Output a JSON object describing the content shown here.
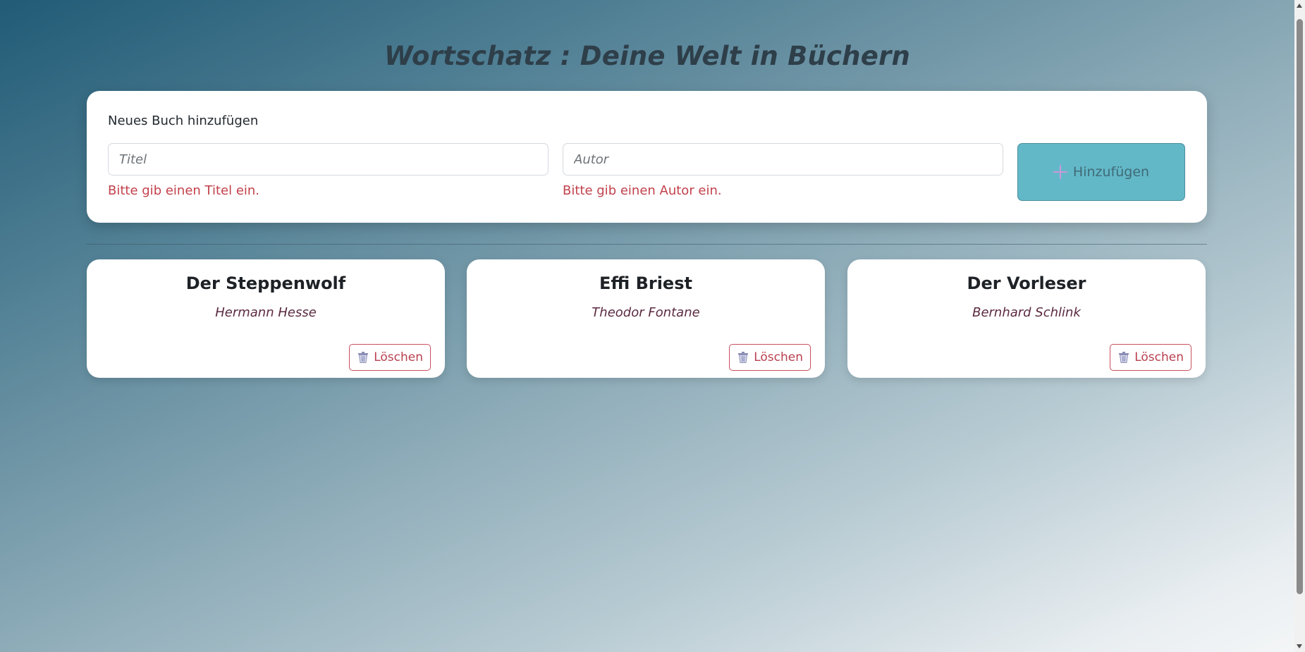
{
  "header": {
    "title": "Wortschatz : Deine Welt in Büchern"
  },
  "add_form": {
    "heading": "Neues Buch hinzufügen",
    "title_input": {
      "placeholder": "Titel",
      "value": ""
    },
    "author_input": {
      "placeholder": "Autor",
      "value": ""
    },
    "title_error": "Bitte gib einen Titel ein.",
    "author_error": "Bitte gib einen Autor ein.",
    "submit_label": "Hinzufügen",
    "submit_icon": "plus-icon"
  },
  "books": [
    {
      "title": "Der Steppenwolf",
      "author": "Hermann Hesse",
      "delete_label": "Löschen",
      "delete_icon": "trash-icon"
    },
    {
      "title": "Effi Briest",
      "author": "Theodor Fontane",
      "delete_label": "Löschen",
      "delete_icon": "trash-icon"
    },
    {
      "title": "Der Vorleser",
      "author": "Bernhard Schlink",
      "delete_label": "Löschen",
      "delete_icon": "trash-icon"
    }
  ],
  "colors": {
    "accent_button": "#63b8c8",
    "error": "#c2414b",
    "author_text": "#5b2a40"
  }
}
